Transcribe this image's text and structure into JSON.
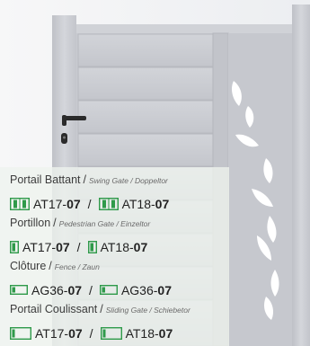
{
  "colors": {
    "accent": "#2f9a4a",
    "overlay": "#eef4ee",
    "gate": "#c9cbd1"
  },
  "products": [
    {
      "name": "Portail Battant",
      "subtitle": "Swing Gate / Doppeltor",
      "models": [
        {
          "icon": "double-leaf-gate-icon",
          "prefix": "AT17-",
          "suffix": "07"
        },
        {
          "icon": "double-leaf-gate-icon",
          "prefix": "AT18-",
          "suffix": "07"
        }
      ]
    },
    {
      "name": "Portillon",
      "subtitle": "Pedestrian Gate / Einzeltor",
      "models": [
        {
          "icon": "single-leaf-gate-icon",
          "prefix": "AT17-",
          "suffix": "07"
        },
        {
          "icon": "single-leaf-gate-icon",
          "prefix": "AT18-",
          "suffix": "07"
        }
      ]
    },
    {
      "name": "Clôture",
      "subtitle": "Fence / Zaun",
      "models": [
        {
          "icon": "fence-panel-icon",
          "prefix": "AG36-",
          "suffix": "07"
        },
        {
          "icon": "fence-panel-icon",
          "prefix": "AG36-",
          "suffix": "07"
        }
      ]
    },
    {
      "name": "Portail Coulissant",
      "subtitle": "Sliding Gate / Schiebetor",
      "models": [
        {
          "icon": "sliding-gate-icon",
          "prefix": "AT17-",
          "suffix": "07"
        },
        {
          "icon": "sliding-gate-icon",
          "prefix": "AT18-",
          "suffix": "07"
        }
      ]
    }
  ],
  "divider": "/",
  "title_separator": "/"
}
